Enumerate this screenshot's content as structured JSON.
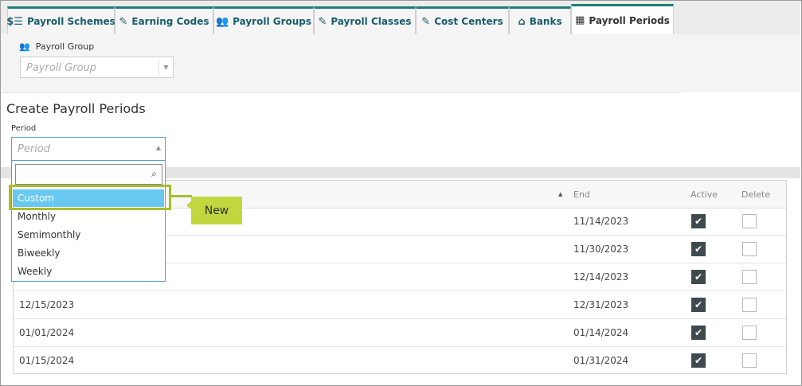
{
  "tabs": [
    {
      "label": "Payroll Schemes",
      "icon": "dollar-doc-icon",
      "glyph": "$☰"
    },
    {
      "label": "Earning Codes",
      "icon": "edit-doc-icon",
      "glyph": "✎"
    },
    {
      "label": "Payroll Groups",
      "icon": "group-icon",
      "glyph": "👥"
    },
    {
      "label": "Payroll Classes",
      "icon": "edit-doc-icon",
      "glyph": "✎"
    },
    {
      "label": "Cost Centers",
      "icon": "edit-doc-icon",
      "glyph": "✎"
    },
    {
      "label": "Banks",
      "icon": "bank-icon",
      "glyph": "⌂"
    },
    {
      "label": "Payroll Periods",
      "icon": "calendar-icon",
      "glyph": "▦",
      "active": true
    }
  ],
  "filter": {
    "label": "Payroll Group",
    "icon_glyph": "👥",
    "placeholder": "Payroll Group"
  },
  "section": {
    "title": "Create Payroll Periods",
    "period_label": "Period",
    "period_placeholder": "Period"
  },
  "dropdown": {
    "search_value": "",
    "items": [
      "Custom",
      "Monthly",
      "Semimonthly",
      "Biweekly",
      "Weekly"
    ],
    "selected": "Custom"
  },
  "callout": {
    "label": "New",
    "color": "#c2d63f"
  },
  "grid": {
    "headers": {
      "end": "End",
      "active": "Active",
      "delete": "Delete",
      "sort_glyph": "▲"
    },
    "rows": [
      {
        "start": "",
        "end": "11/14/2023",
        "active": true,
        "delete": false
      },
      {
        "start": "",
        "end": "11/30/2023",
        "active": true,
        "delete": false
      },
      {
        "start": "",
        "end": "12/14/2023",
        "active": true,
        "delete": false
      },
      {
        "start": "12/15/2023",
        "end": "12/31/2023",
        "active": true,
        "delete": false
      },
      {
        "start": "01/01/2024",
        "end": "01/14/2024",
        "active": true,
        "delete": false
      },
      {
        "start": "01/15/2024",
        "end": "01/31/2024",
        "active": true,
        "delete": false
      }
    ]
  },
  "colors": {
    "tab_accent": "#1e7d78",
    "tab_text": "#1a5c6b",
    "selection": "#68c8f0",
    "checkbox_on": "#3f4a4f"
  }
}
